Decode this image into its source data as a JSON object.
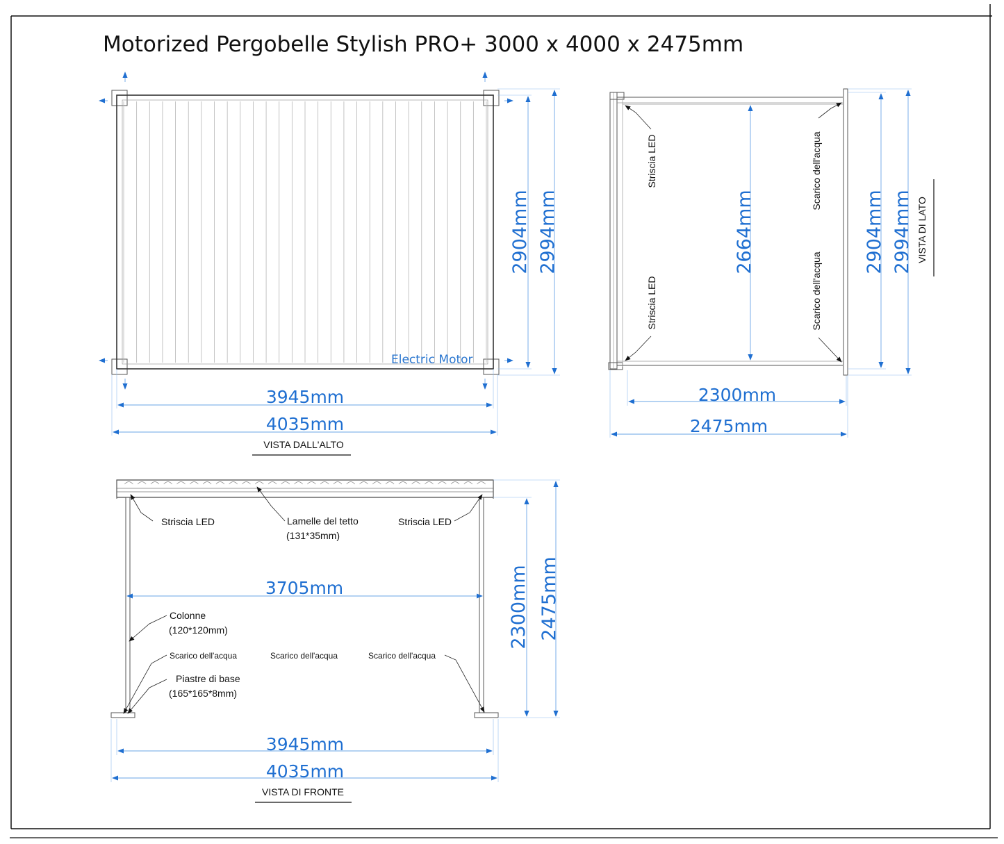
{
  "title": "Motorized Pergobelle Stylish PRO+ 3000 x 4000 x 2475mm",
  "colors": {
    "dimension": "#1f6fd1",
    "structure": "#555555",
    "text": "#111111"
  },
  "top_view": {
    "label": "VISTA DALL'ALTO",
    "motor_label": "Electric Motor",
    "dims": {
      "inner_width": "3945mm",
      "outer_width": "4035mm",
      "inner_depth": "2904mm",
      "outer_depth": "2994mm"
    },
    "louver_count": 28
  },
  "side_view": {
    "label": "VISTA DI LATO",
    "dims": {
      "inner_height": "2664mm",
      "frame_depth": "2904mm",
      "outer_depth": "2994mm",
      "inner_width": "2300mm",
      "outer_width": "2475mm"
    },
    "notes": {
      "led_top": "Striscia LED",
      "led_bottom": "Striscia LED",
      "drain_top": "Scarico dell'acqua",
      "drain_bottom": "Scarico dell'acqua"
    }
  },
  "front_view": {
    "label": "VISTA DI FRONTE",
    "dims": {
      "clear_width": "3705mm",
      "inner_width": "3945mm",
      "outer_width": "4035mm",
      "clear_height": "2300mm",
      "total_height": "2475mm"
    },
    "notes": {
      "led_left": "Striscia LED",
      "led_right": "Striscia LED",
      "louvers": "Lamelle del tetto",
      "louvers_size": "(131*35mm)",
      "columns": "Colonne",
      "columns_size": "(120*120mm)",
      "drain_left": "Scarico dell'acqua",
      "drain_center": "Scarico dell'acqua",
      "drain_right": "Scarico dell'acqua",
      "base_plates": "Piastre di base",
      "base_plates_size": "(165*165*8mm)"
    },
    "louver_count": 28
  }
}
